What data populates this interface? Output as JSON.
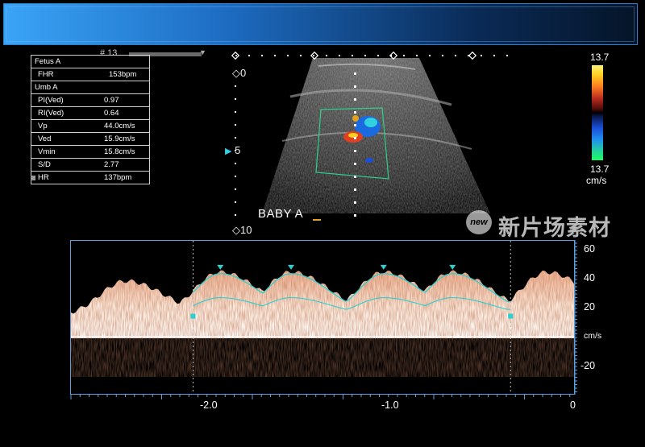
{
  "header": {
    "frame_label": "# 13"
  },
  "measurements": {
    "fetus_section": "Fetus A",
    "fhr": {
      "label": "FHR",
      "value": "153bpm"
    },
    "umb_section": "Umb A",
    "rows": [
      {
        "label": "PI(Ved)",
        "value": "0.97"
      },
      {
        "label": "RI(Ved)",
        "value": "0.64"
      },
      {
        "label": "Vp",
        "value": "44.0cm/s"
      },
      {
        "label": "Ved",
        "value": "15.9cm/s"
      },
      {
        "label": "Vmin",
        "value": "15.8cm/s"
      },
      {
        "label": "S/D",
        "value": "2.77"
      },
      {
        "label": "HR",
        "value": "137bpm"
      }
    ]
  },
  "image": {
    "annotation": "BABY A",
    "depth_markers": [
      "0",
      "5",
      "10"
    ]
  },
  "color_scale": {
    "top": "13.7",
    "bottom": "13.7",
    "unit": "cm/s",
    "colors": {
      "positive": "#ffd020",
      "negative": "#1a4fd8",
      "accent": "#2a7fd0"
    }
  },
  "watermark": {
    "logo_text": "new",
    "text": "新片场素材"
  },
  "spectral": {
    "unit": "cm/s",
    "y_ticks": [
      "60",
      "40",
      "20",
      "-20"
    ],
    "x_ticks": [
      "-2.0",
      "-1.0",
      "0"
    ],
    "trace_color": "#2ecfcf",
    "peak_times_s": [
      -1.95,
      -1.56,
      -1.05,
      -0.67
    ],
    "peak_velocity_cm_s": 44.0
  }
}
